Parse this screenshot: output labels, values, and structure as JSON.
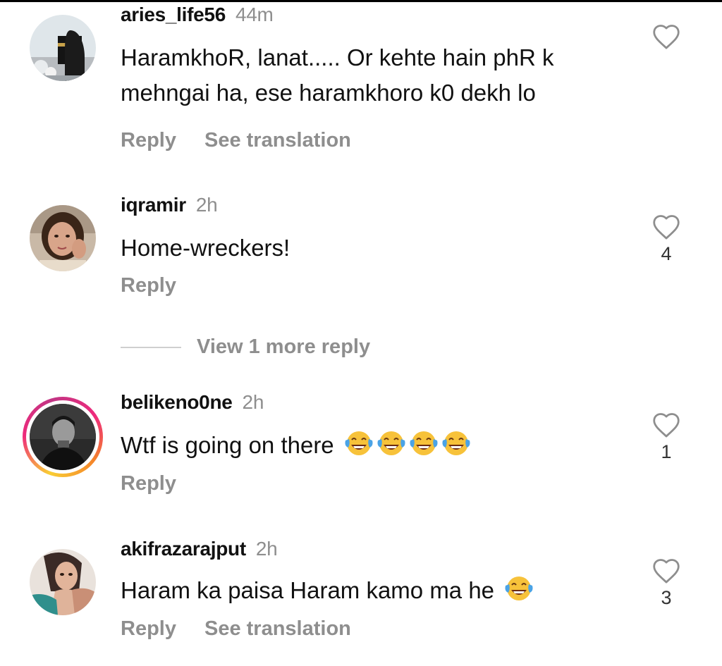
{
  "comments": [
    {
      "username": "aries_life56",
      "time": "44m",
      "text_lines": [
        "HaramkhoR, lanat..... Or kehte hain phR k",
        "mehngai ha, ese haramkhoro k0 dekh lo"
      ],
      "reply_label": "Reply",
      "translate_label": "See translation",
      "likes": ""
    },
    {
      "username": "iqramir",
      "time": "2h",
      "text": "Home-wreckers!",
      "reply_label": "Reply",
      "likes": "4",
      "view_more_label": "View 1 more reply"
    },
    {
      "username": "belikeno0ne",
      "time": "2h",
      "text": "Wtf is going on there",
      "emoji_count": 4,
      "emoji": "face-with-tears-of-joy",
      "reply_label": "Reply",
      "likes": "1",
      "has_story_ring": true
    },
    {
      "username": "akifrazarajput",
      "time": "2h",
      "text": "Haram ka paisa Haram kamo ma he",
      "emoji_count": 1,
      "emoji": "face-with-tears-of-joy",
      "reply_label": "Reply",
      "translate_label": "See translation",
      "likes": "3"
    }
  ],
  "icons": {
    "like": "heart-outline-icon",
    "emoji": "face-with-tears-of-joy-icon"
  },
  "colors": {
    "text": "#111111",
    "muted": "#8e8e8e",
    "story_ring": [
      "#f9ce34",
      "#ee2a7b",
      "#c13584"
    ]
  }
}
